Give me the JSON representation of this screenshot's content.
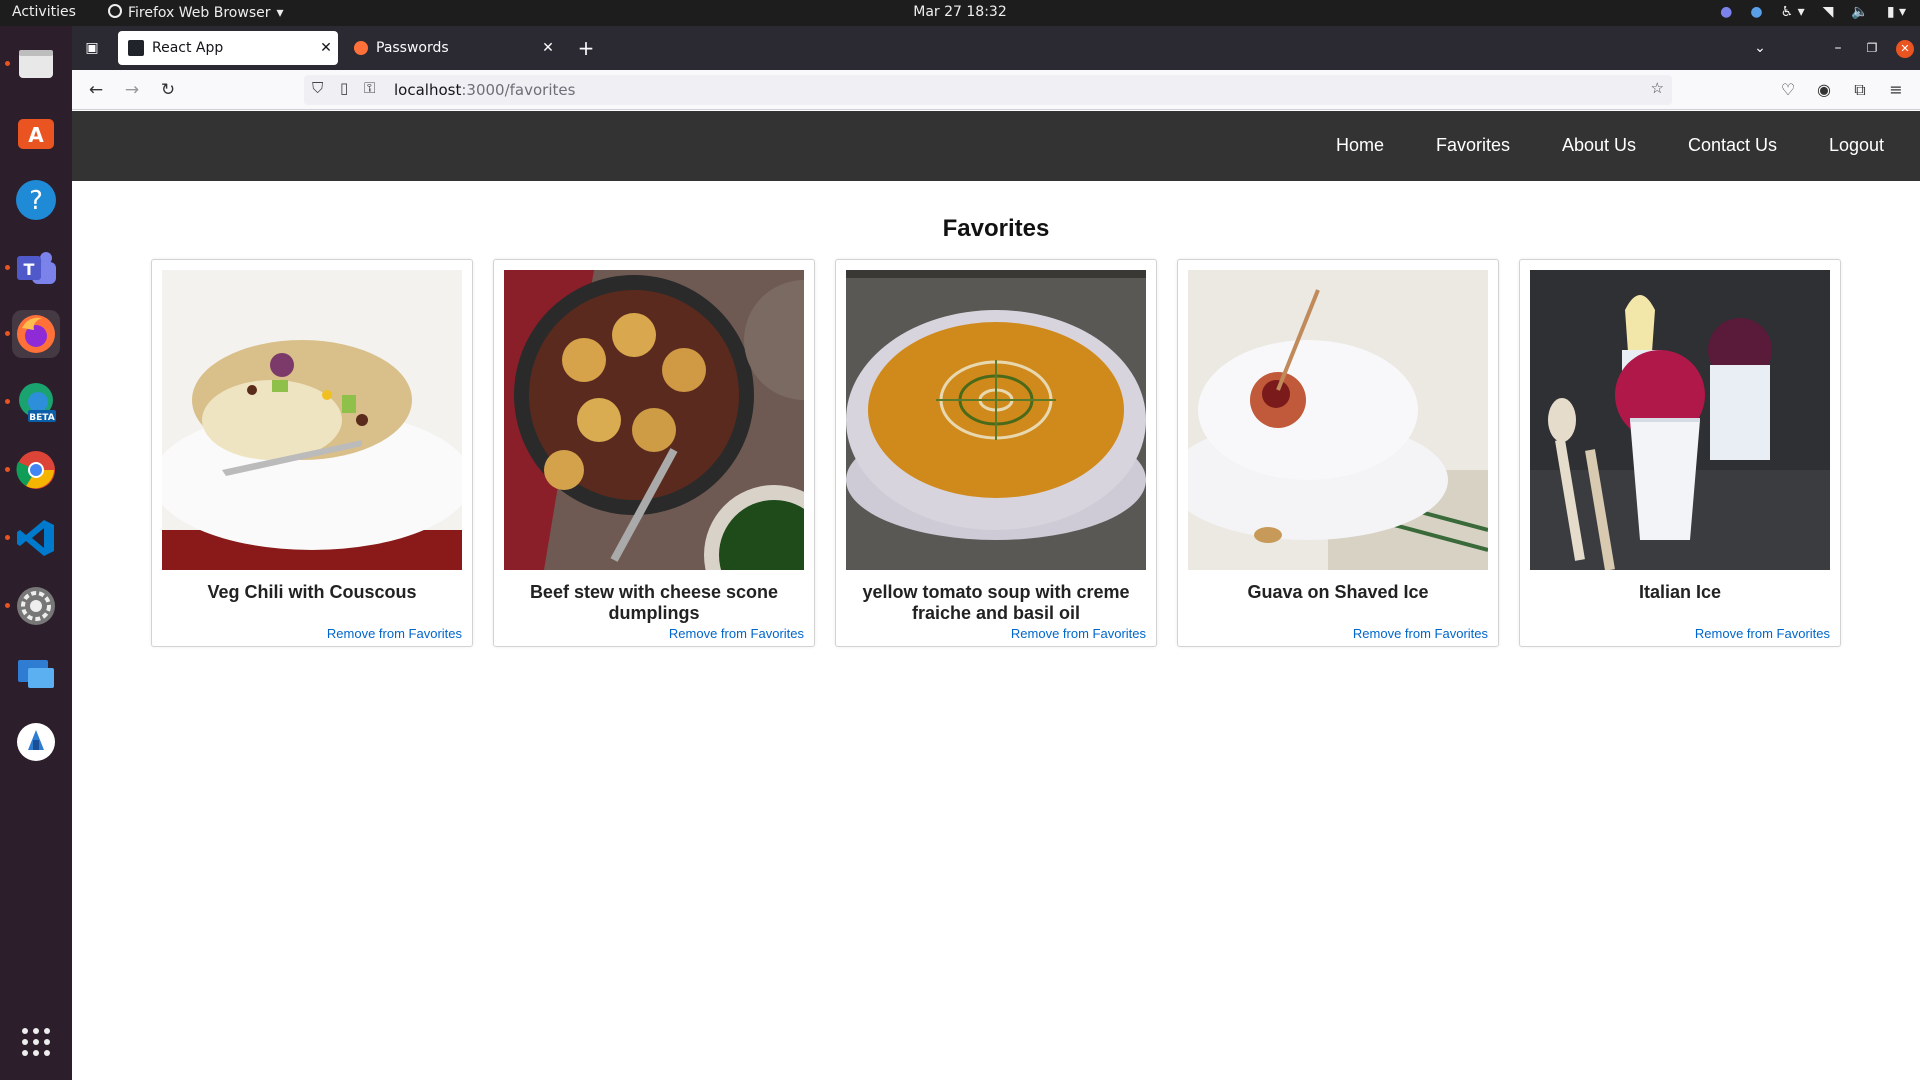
{
  "system": {
    "activities": "Activities",
    "app_name": "Firefox Web Browser",
    "clock": "Mar 27  18:32"
  },
  "browser": {
    "tabs": [
      {
        "title": "React App",
        "active": true
      },
      {
        "title": "Passwords",
        "active": false
      }
    ],
    "url_host": "localhost",
    "url_path": ":3000/favorites"
  },
  "dock": {
    "items": [
      "files-icon",
      "app-center-icon",
      "help-icon",
      "teams-icon",
      "firefox-icon",
      "edge-beta-icon",
      "chrome-icon",
      "vscode-icon",
      "settings-icon",
      "remote-desktop-icon",
      "software-updater-icon"
    ],
    "beta_label": "BETA",
    "show_apps": "show-applications-icon"
  },
  "app": {
    "nav": [
      "Home",
      "Favorites",
      "About Us",
      "Contact Us",
      "Logout"
    ],
    "page_title": "Favorites",
    "remove_label": "Remove from Favorites",
    "favorites": [
      {
        "name": "Veg Chili with Couscous"
      },
      {
        "name": "Beef stew with cheese scone dumplings"
      },
      {
        "name": "yellow tomato soup with creme fraiche and basil oil"
      },
      {
        "name": "Guava on Shaved Ice"
      },
      {
        "name": "Italian Ice"
      }
    ]
  },
  "colors": {
    "app_nav_bg": "#333333",
    "link": "#0066cc",
    "dock_bg": "#2c1e2a",
    "accent": "#e95420"
  }
}
